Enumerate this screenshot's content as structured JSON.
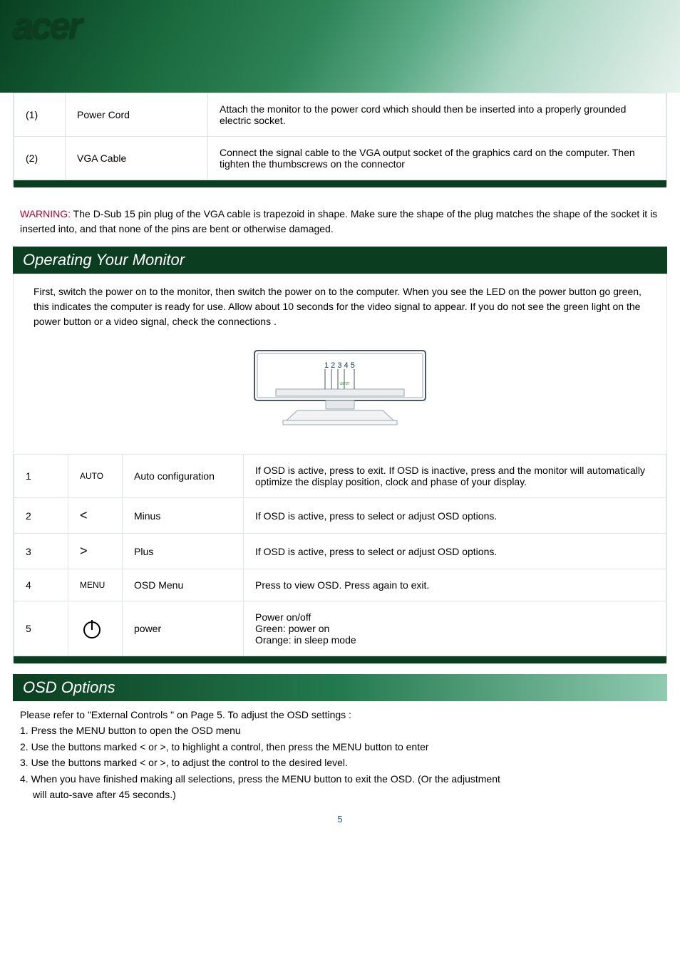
{
  "brand": "acer",
  "connections": {
    "rows": [
      {
        "num": "(1)",
        "item": "Power Cord",
        "desc": "Attach the monitor to the power cord which should then be inserted into a properly grounded electric socket."
      },
      {
        "num": "(2)",
        "item": "VGA Cable",
        "desc": "Connect the signal cable to the VGA output socket of the graphics card on the computer. Then tighten the thumbscrews on the connector"
      }
    ]
  },
  "warning": {
    "label": "WARNING:",
    "text": " The D-Sub 15 pin plug of the VGA cable is trapezoid in shape. Make sure the shape of the plug matches the shape of the socket it is inserted into, and that none of the pins are bent or otherwise damaged."
  },
  "sections": {
    "operating": "Operating Your Monitor",
    "osd": "OSD Options"
  },
  "operating_intro": "First, switch the power on to the monitor, then switch the power on to the computer. When you see the LED on the power button go green, this indicates  the computer is ready  for use. Allow about 10 seconds for the video signal to appear. If you do not see the green light on the power button or a video signal, check the connections .",
  "monitor_labels": "1 2 3 4  5",
  "buttons": {
    "rows": [
      {
        "n": "1",
        "sym": "AUTO",
        "fn": "Auto configuration",
        "desc": "If OSD is active, press to exit. If OSD is inactive, press and the monitor will automatically optimize the display position, clock and phase of your display."
      },
      {
        "n": "2",
        "sym": "<",
        "fn": "Minus",
        "desc": "If OSD is active, press to select or adjust OSD options."
      },
      {
        "n": "3",
        "sym": ">",
        "fn": "Plus",
        "desc": "If OSD is active, press to select or adjust OSD options."
      },
      {
        "n": "4",
        "sym": "MENU",
        "fn": "OSD Menu",
        "desc": "Press to view OSD. Press again to exit."
      },
      {
        "n": "5",
        "sym": "PWR",
        "fn": "power",
        "desc": "Power on/off\nGreen: power on\nOrange: in sleep mode"
      }
    ]
  },
  "osd_intro": "Please refer to \"External Controls \" on Page 5. To adjust the OSD settings :",
  "osd_steps": [
    "1. Press the MENU button  to open the OSD menu",
    "2. Use the buttons marked  < or >, to highlight a control, then press  the MENU button  to enter",
    "3. Use the buttons marked  < or >, to adjust the control to the desired level.",
    "4. When you have finished making all selections, press the MENU button to exit the OSD. (Or the adjustment",
    "will auto-save  after 45 seconds.)"
  ],
  "page_number": "5",
  "power_icon_name": "power-icon"
}
